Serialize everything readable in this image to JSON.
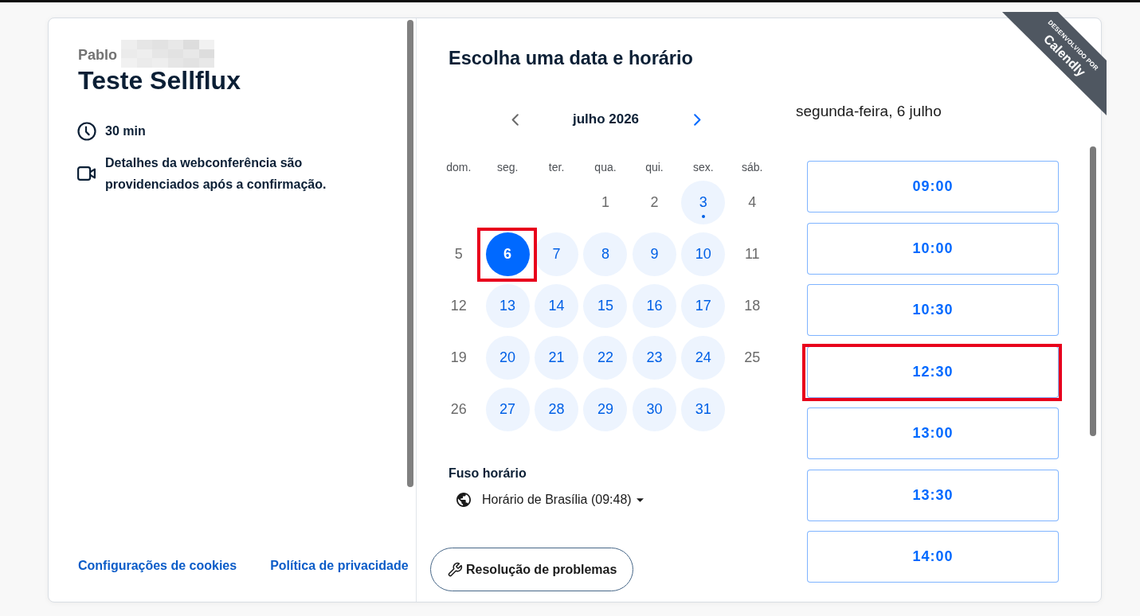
{
  "organizer": {
    "name": "Pablo",
    "name_redacted": true
  },
  "event": {
    "title": "Teste Sellflux",
    "details": [
      {
        "kind": "duration",
        "text": "30 min"
      },
      {
        "kind": "video",
        "text": "Detalhes da webconferência são providenciados após a confirmação."
      }
    ]
  },
  "footer_links": [
    "Configurações de cookies",
    "Política de privacidade"
  ],
  "scheduler": {
    "heading": "Escolha uma data e horário",
    "calendar": {
      "month": "julho 2026",
      "nav": [
        {
          "kind": "prev",
          "disabled": true
        },
        {
          "kind": "next",
          "disabled": false
        }
      ],
      "weekdays": [
        "dom.",
        "seg.",
        "ter.",
        "qua.",
        "qui.",
        "sex.",
        "sáb."
      ],
      "weeks": [
        {
          "days": [
            {
              "label": "1",
              "available": false,
              "selected": false,
              "today": false,
              "annotated": false
            },
            {
              "label": "2",
              "available": false,
              "selected": false,
              "today": false,
              "annotated": false
            },
            {
              "label": "3",
              "available": true,
              "selected": false,
              "today": true,
              "annotated": false
            },
            {
              "label": "4",
              "available": false,
              "selected": false,
              "today": false,
              "annotated": false
            }
          ]
        },
        {
          "days": [
            {
              "label": "5",
              "available": false,
              "selected": false,
              "today": false,
              "annotated": false
            },
            {
              "label": "6",
              "available": true,
              "selected": true,
              "today": false,
              "annotated": true
            },
            {
              "label": "7",
              "available": true,
              "selected": false,
              "today": false,
              "annotated": false
            },
            {
              "label": "8",
              "available": true,
              "selected": false,
              "today": false,
              "annotated": false
            },
            {
              "label": "9",
              "available": true,
              "selected": false,
              "today": false,
              "annotated": false
            },
            {
              "label": "10",
              "available": true,
              "selected": false,
              "today": false,
              "annotated": false
            },
            {
              "label": "11",
              "available": false,
              "selected": false,
              "today": false,
              "annotated": false
            }
          ]
        },
        {
          "days": [
            {
              "label": "12",
              "available": false,
              "selected": false,
              "today": false,
              "annotated": false
            },
            {
              "label": "13",
              "available": true,
              "selected": false,
              "today": false,
              "annotated": false
            },
            {
              "label": "14",
              "available": true,
              "selected": false,
              "today": false,
              "annotated": false
            },
            {
              "label": "15",
              "available": true,
              "selected": false,
              "today": false,
              "annotated": false
            },
            {
              "label": "16",
              "available": true,
              "selected": false,
              "today": false,
              "annotated": false
            },
            {
              "label": "17",
              "available": true,
              "selected": false,
              "today": false,
              "annotated": false
            },
            {
              "label": "18",
              "available": false,
              "selected": false,
              "today": false,
              "annotated": false
            }
          ]
        },
        {
          "days": [
            {
              "label": "19",
              "available": false,
              "selected": false,
              "today": false,
              "annotated": false
            },
            {
              "label": "20",
              "available": true,
              "selected": false,
              "today": false,
              "annotated": false
            },
            {
              "label": "21",
              "available": true,
              "selected": false,
              "today": false,
              "annotated": false
            },
            {
              "label": "22",
              "available": true,
              "selected": false,
              "today": false,
              "annotated": false
            },
            {
              "label": "23",
              "available": true,
              "selected": false,
              "today": false,
              "annotated": false
            },
            {
              "label": "24",
              "available": true,
              "selected": false,
              "today": false,
              "annotated": false
            },
            {
              "label": "25",
              "available": false,
              "selected": false,
              "today": false,
              "annotated": false
            }
          ]
        },
        {
          "days": [
            {
              "label": "26",
              "available": false,
              "selected": false,
              "today": false,
              "annotated": false
            },
            {
              "label": "27",
              "available": true,
              "selected": false,
              "today": false,
              "annotated": false
            },
            {
              "label": "28",
              "available": true,
              "selected": false,
              "today": false,
              "annotated": false
            },
            {
              "label": "29",
              "available": true,
              "selected": false,
              "today": false,
              "annotated": false
            },
            {
              "label": "30",
              "available": true,
              "selected": false,
              "today": false,
              "annotated": false
            },
            {
              "label": "31",
              "available": true,
              "selected": false,
              "today": false,
              "annotated": false
            }
          ]
        }
      ]
    },
    "timezone": {
      "label": "Fuso horário",
      "value": "Horário de Brasília (09:48)"
    },
    "troubleshoot_button": "Resolução de problemas",
    "day_panel": {
      "heading": "segunda-feira, 6 julho",
      "slots": [
        {
          "time": "09:00",
          "annotated": false
        },
        {
          "time": "10:00",
          "annotated": false
        },
        {
          "time": "10:30",
          "annotated": false
        },
        {
          "time": "12:30",
          "annotated": true
        },
        {
          "time": "13:00",
          "annotated": false
        },
        {
          "time": "13:30",
          "annotated": false
        },
        {
          "time": "14:00",
          "annotated": false
        }
      ]
    }
  },
  "ribbon": {
    "caption": "DESENVOLVIDO POR",
    "brand": "Calendly"
  }
}
